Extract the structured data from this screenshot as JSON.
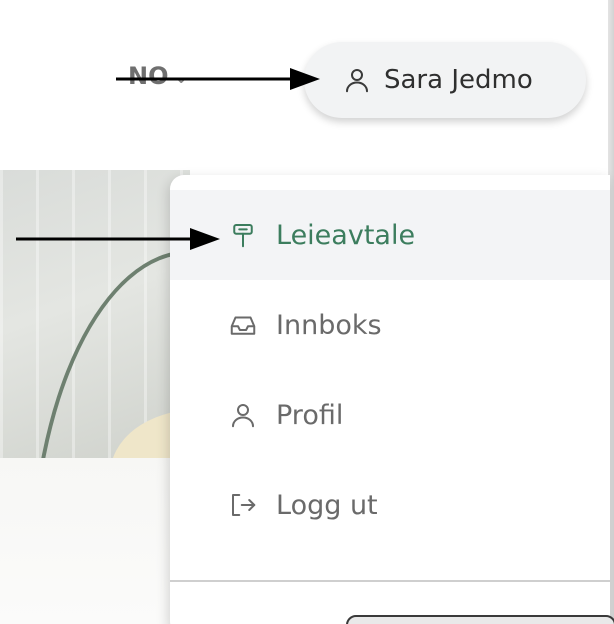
{
  "header": {
    "language": {
      "label": "NO",
      "icon": "chevron-down-icon"
    },
    "user": {
      "name": "Sara Jedmo",
      "icon": "user-icon"
    }
  },
  "dropdown": {
    "items": [
      {
        "label": "Leieavtale",
        "icon": "signpost-icon",
        "active": true
      },
      {
        "label": "Innboks",
        "icon": "inbox-icon",
        "active": false
      },
      {
        "label": "Profil",
        "icon": "user-icon",
        "active": false
      },
      {
        "label": "Logg ut",
        "icon": "logout-icon",
        "active": false
      }
    ]
  },
  "colors": {
    "accent": "#3c7d5e",
    "user_button_bg": "#f2f3f4",
    "active_item_bg": "#f3f4f6",
    "text_muted": "#6a6a6a",
    "arrow": "#000000"
  }
}
